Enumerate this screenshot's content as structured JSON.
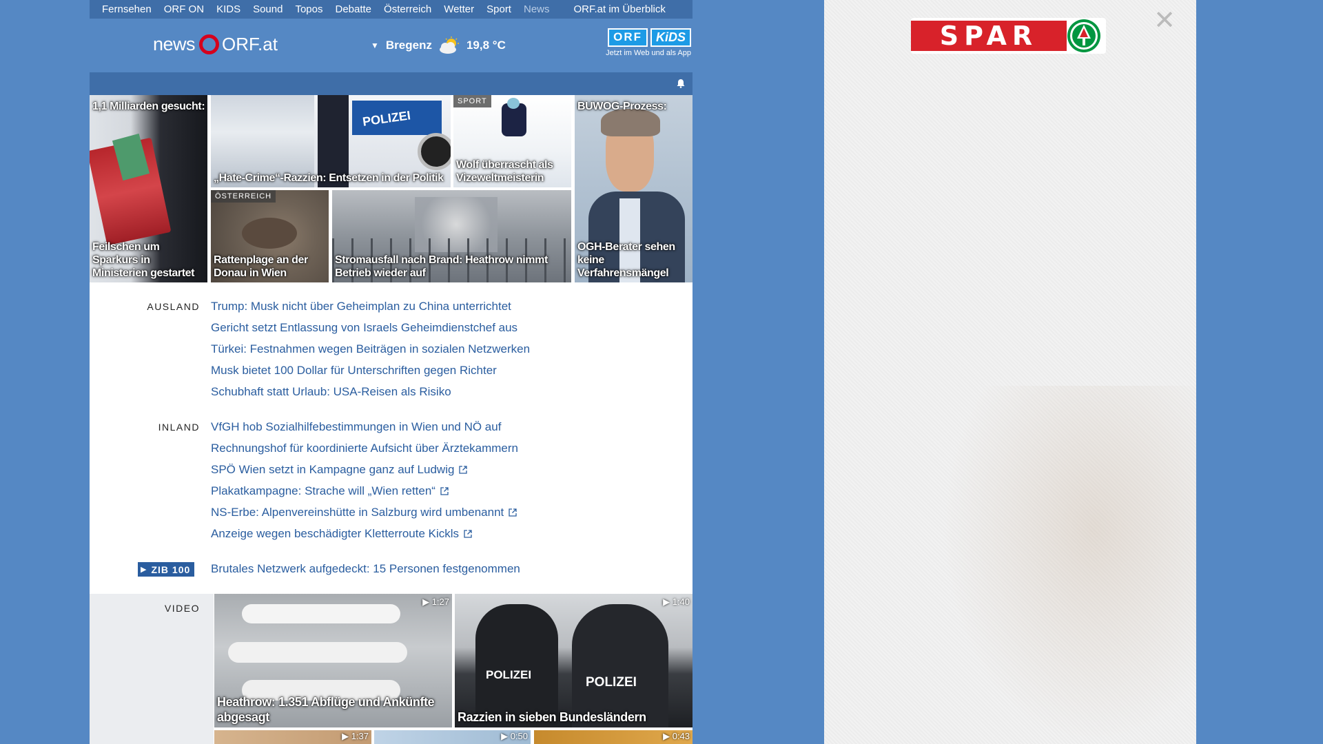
{
  "nav": {
    "items": [
      "Fernsehen",
      "ORF ON",
      "KIDS",
      "Sound",
      "Topos",
      "Debatte",
      "Österreich",
      "Wetter",
      "Sport",
      "News"
    ],
    "active": "News",
    "overview": "ORF.at im Überblick"
  },
  "header": {
    "logo_news": "news",
    "logo_orf": "ORF.at",
    "weather_city": "Bregenz",
    "weather_temp": "19,8 °C",
    "kids_orf": "ORF",
    "kids_label": "KiDS",
    "kids_sub": "Jetzt im Web und als App"
  },
  "tiles": [
    {
      "toptitle": "1,1 Milliarden gesucht:",
      "caption": "Feilschen um Sparkurs in Ministerien gestartet"
    },
    {
      "caption": "„Hate-Crime“-Razzien: Entsetzen in der Politik"
    },
    {
      "badge": "SPORT",
      "caption": "Wolf überrascht als Vizeweltmeisterin"
    },
    {
      "toptitle": "BUWOG-Prozess:",
      "caption": "OGH-Berater sehen keine Verfahrensmängel"
    },
    {
      "badge": "ÖSTERREICH",
      "caption": "Rattenplage an der Donau in Wien"
    },
    {
      "caption": "Stromausfall nach Brand: Heathrow nimmt Betrieb wieder auf"
    }
  ],
  "sections": {
    "ausland": {
      "label": "AUSLAND",
      "headlines": [
        "Trump: Musk nicht über Geheimplan zu China unterrichtet",
        "Gericht setzt Entlassung von Israels Geheimdienstchef aus",
        "Türkei: Festnahmen wegen Beiträgen in sozialen Netzwerken",
        "Musk bietet 100 Dollar für Unterschriften gegen Richter",
        "Schubhaft statt Urlaub: USA-Reisen als Risiko"
      ]
    },
    "inland": {
      "label": "INLAND",
      "headlines": [
        "VfGH hob Sozialhilfebestimmungen in Wien und NÖ auf",
        "Rechnungshof für koordinierte Aufsicht über Ärztekammern",
        "SPÖ Wien setzt in Kampagne ganz auf Ludwig",
        "Plakatkampagne: Strache will „Wien retten“",
        "NS-Erbe: Alpenvereinshütte in Salzburg wird umbenannt",
        "Anzeige wegen beschädigter Kletterroute Kickls"
      ]
    },
    "zib": {
      "play": "▶",
      "label": "ZIB 100",
      "headline": "Brutales Netzwerk aufgedeckt: 15 Personen festgenommen"
    },
    "video": {
      "label": "VIDEO",
      "items": [
        {
          "duration": "1:27",
          "caption": "Heathrow: 1.351 Abflüge und Ankünfte abgesagt"
        },
        {
          "duration": "1:40",
          "caption": "Razzien in sieben Bundesländern"
        },
        {
          "duration": "1:37",
          "caption": ""
        },
        {
          "duration": "0:50",
          "caption": ""
        },
        {
          "duration": "0:43",
          "caption": ""
        }
      ]
    }
  },
  "ad": {
    "brand": "SPAR",
    "close": "✕"
  },
  "colors": {
    "background": "#5588c4",
    "nav": "#3f6ea8",
    "link": "#2a5d9f",
    "orf_red": "#d6001c",
    "spar_red": "#d8222a",
    "spar_green": "#009640"
  }
}
